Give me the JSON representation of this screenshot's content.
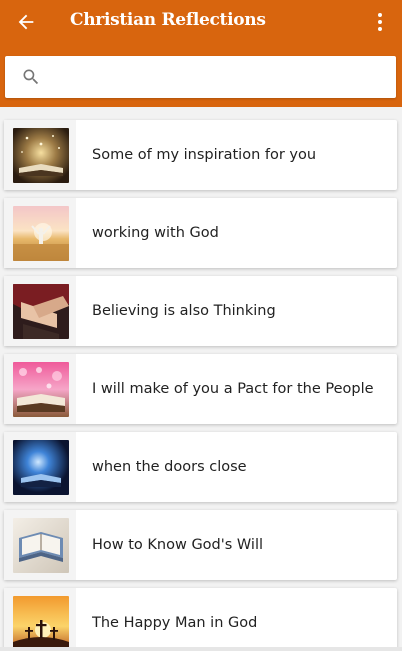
{
  "header": {
    "title": "Christian Reflections",
    "back_icon": "arrow-left-icon",
    "menu_icon": "more-vertical-icon",
    "background": "#d8650e"
  },
  "search": {
    "placeholder": "",
    "value": "",
    "icon": "search-icon"
  },
  "items": [
    {
      "label": "Some of my inspiration for you",
      "thumb": "glowing-open-book"
    },
    {
      "label": "working with God",
      "thumb": "person-in-wheat-field"
    },
    {
      "label": "Believing is also Thinking",
      "thumb": "hands-on-bible"
    },
    {
      "label": "I will make of you a Pact for the People",
      "thumb": "book-with-pink-bokeh"
    },
    {
      "label": "when the doors close",
      "thumb": "bible-with-blue-light"
    },
    {
      "label": "How to Know God's Will",
      "thumb": "open-bible"
    },
    {
      "label": "The Happy Man in God",
      "thumb": "crosses-at-sunset"
    }
  ]
}
